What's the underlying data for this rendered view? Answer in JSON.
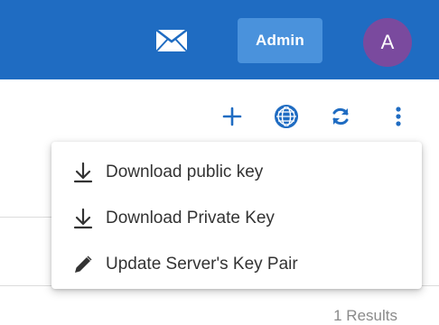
{
  "header": {
    "mail_icon": "envelope-icon",
    "admin_label": "Admin",
    "avatar_initial": "A",
    "colors": {
      "bar": "#1f6cc2",
      "admin_button": "#4a92dc",
      "avatar": "#7a4a9e"
    }
  },
  "toolbar": {
    "icons": [
      "plus-icon",
      "globe-icon",
      "refresh-icon",
      "more-vertical-icon"
    ],
    "icon_color": "#1f6cc2"
  },
  "menu": {
    "items": [
      {
        "label": "Download public key",
        "icon": "download-icon"
      },
      {
        "label": "Download Private Key",
        "icon": "download-icon"
      },
      {
        "label": "Update Server's Key Pair",
        "icon": "pencil-icon"
      }
    ]
  },
  "footer": {
    "results_label": "1 Results"
  }
}
